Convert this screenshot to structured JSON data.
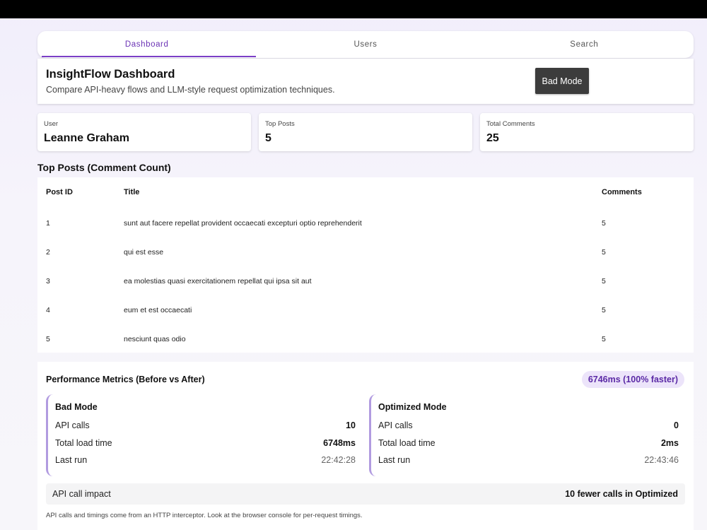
{
  "tabs": [
    {
      "label": "Dashboard"
    },
    {
      "label": "Users"
    },
    {
      "label": "Search"
    }
  ],
  "header": {
    "title": "InsightFlow Dashboard",
    "subtitle": "Compare API-heavy flows and LLM-style request optimization techniques.",
    "mode_button": "Bad Mode"
  },
  "stats": {
    "user": {
      "label": "User",
      "value": "Leanne Graham"
    },
    "top_posts": {
      "label": "Top Posts",
      "value": "5"
    },
    "total_comments": {
      "label": "Total Comments",
      "value": "25"
    }
  },
  "posts_section": {
    "title": "Top Posts (Comment Count)",
    "columns": {
      "id": "Post ID",
      "title": "Title",
      "comments": "Comments"
    },
    "rows": [
      {
        "id": "1",
        "title": "sunt aut facere repellat provident occaecati excepturi optio reprehenderit",
        "comments": "5"
      },
      {
        "id": "2",
        "title": "qui est esse",
        "comments": "5"
      },
      {
        "id": "3",
        "title": "ea molestias quasi exercitationem repellat qui ipsa sit aut",
        "comments": "5"
      },
      {
        "id": "4",
        "title": "eum et est occaecati",
        "comments": "5"
      },
      {
        "id": "5",
        "title": "nesciunt quas odio",
        "comments": "5"
      }
    ]
  },
  "performance": {
    "title": "Performance Metrics (Before vs After)",
    "badge": "6746ms (100% faster)",
    "bad": {
      "title": "Bad Mode",
      "api_calls_label": "API calls",
      "api_calls": "10",
      "load_label": "Total load time",
      "load_time": "6748ms",
      "last_run_label": "Last run",
      "last_run": "22:42:28"
    },
    "optimized": {
      "title": "Optimized Mode",
      "api_calls_label": "API calls",
      "api_calls": "0",
      "load_label": "Total load time",
      "load_time": "2ms",
      "last_run_label": "Last run",
      "last_run": "22:43:46"
    },
    "impact_label": "API call impact",
    "impact_value": "10 fewer calls in Optimized",
    "footnote": "API calls and timings come from an HTTP interceptor. Look at the browser console for per-request timings."
  }
}
